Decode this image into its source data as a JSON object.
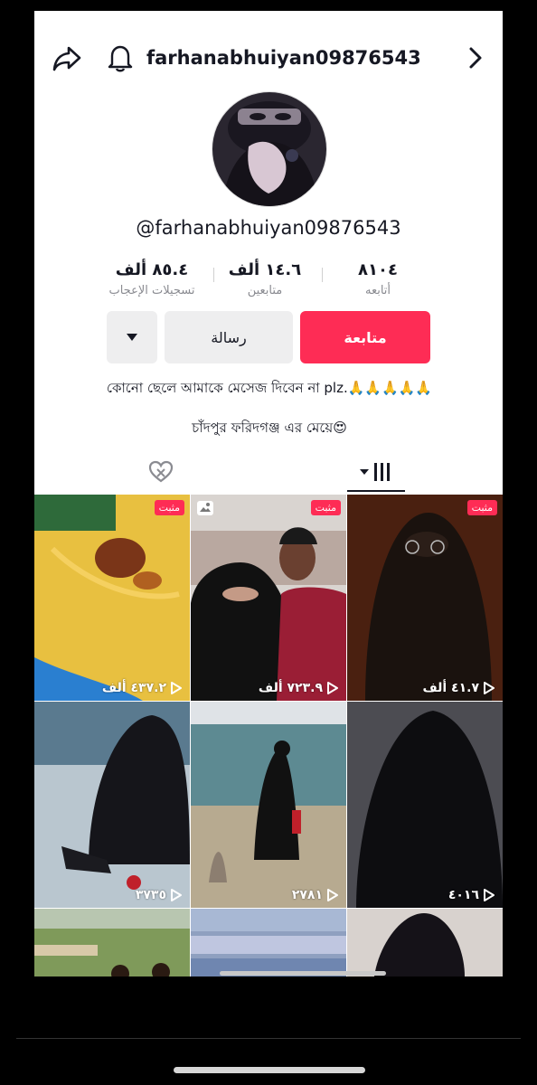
{
  "header": {
    "username": "farhanabhuiyan09876543",
    "icons": [
      "share-icon",
      "bell-icon",
      "chevron-right-icon"
    ]
  },
  "profile": {
    "handle": "@farhanabhuiyan09876543"
  },
  "stats": {
    "likes": {
      "value": "٨٥.٤ ألف",
      "label": "تسجيلات الإعجاب"
    },
    "followers": {
      "value": "١٤.٦ ألف",
      "label": "متابعين"
    },
    "following": {
      "value": "٨١٠٤",
      "label": "أتابعه"
    }
  },
  "actions": {
    "follow_label": "متابعة",
    "message_label": "رسالة",
    "more_icon": "caret-down-icon"
  },
  "bio": {
    "line1": "কোনো ছেলে আমাকে মেসেজ দিবেন না plz.🙏🙏🙏🙏🙏",
    "line2": "চাঁদপুর ফরিদগঞ্জ এর মেয়ে😍"
  },
  "tabs": [
    {
      "name": "liked",
      "icon": "liked-hidden-icon"
    },
    {
      "name": "videos",
      "icon": "grid-icon",
      "active": true
    }
  ],
  "videos": [
    {
      "pinned": "مثبت",
      "views": "٤٣٧.٢ ألف",
      "photo": false
    },
    {
      "pinned": "مثبت",
      "views": "٧٢٣.٩ ألف",
      "photo": true
    },
    {
      "pinned": "مثبت",
      "views": "٤١.٧ ألف",
      "photo": false
    },
    {
      "pinned": "",
      "views": "٣٧٣٥",
      "photo": false
    },
    {
      "pinned": "",
      "views": "٢٧٨١",
      "photo": false
    },
    {
      "pinned": "",
      "views": "٤٠١٦",
      "photo": false
    }
  ],
  "colors": {
    "accent": "#fe2c55",
    "text": "#161823",
    "muted": "#8a8b91"
  }
}
